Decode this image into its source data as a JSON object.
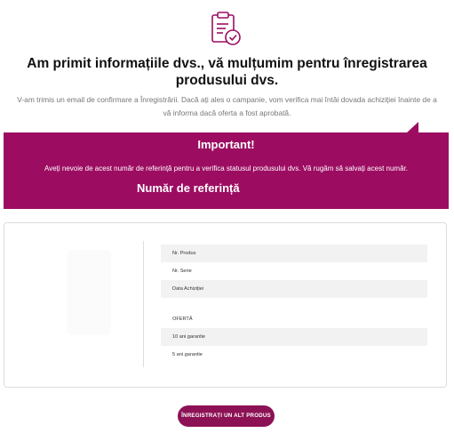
{
  "hero": {
    "icon": "clipboard-check-icon"
  },
  "title": "Am primit informațiile dvs., vă mulțumim pentru înregistrarea produsului dvs.",
  "subtitle": "V-am trimis un email de confirmare a Înregistrării. Dacă ați ales o campanie, vom verifica mai întâi dovada achiziției înainte de a vă informa dacă oferta a fost aprobată.",
  "banner": {
    "heading": "Important!",
    "text": "Aveți nevoie de acest număr de referință pentru a verifica statusul produsului dvs. Vă rugăm să salvați acest număr.",
    "reference_label": "Număr de referință",
    "color": "#9c0d62"
  },
  "details": {
    "rows": [
      {
        "label": "Nr. Produs"
      },
      {
        "label": "Nr. Serie"
      },
      {
        "label": "Data Achiziției"
      },
      {
        "label": "OFERTĂ"
      },
      {
        "label": "10 ani garantie"
      },
      {
        "label": "5 ani garantie"
      }
    ]
  },
  "cta": {
    "label": "ÎNREGISTRAȚI UN ALT PRODUS",
    "color": "#8c1255"
  }
}
